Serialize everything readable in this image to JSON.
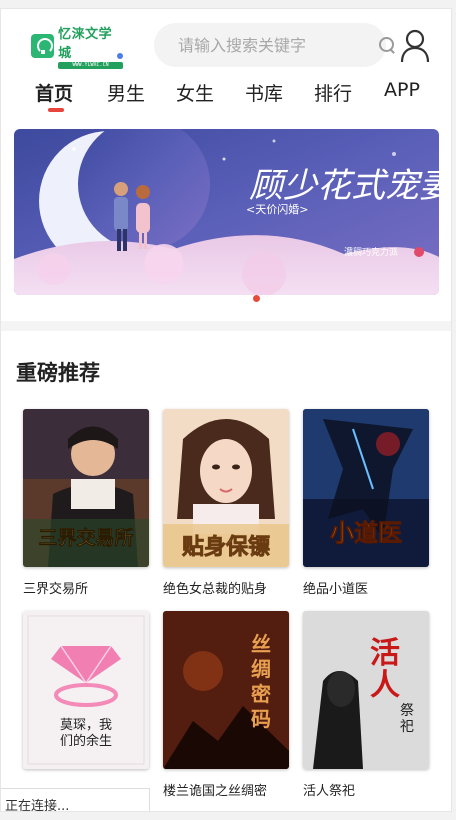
{
  "header": {
    "logo_name": "忆涞文学城",
    "logo_sub": "WWW.YLWXC.CN",
    "search_placeholder": "请输入搜索关键字"
  },
  "nav": {
    "items": [
      {
        "label": "首页",
        "active": true
      },
      {
        "label": "男生",
        "active": false
      },
      {
        "label": "女生",
        "active": false
      },
      {
        "label": "书库",
        "active": false
      },
      {
        "label": "排行",
        "active": false
      },
      {
        "label": "APP",
        "active": false
      }
    ]
  },
  "banner": {
    "title": "顾少花式宠妻",
    "subtitle": "<天价闪婚>",
    "author": "濃稠巧克力派",
    "slide_count": 1,
    "active_slide": 1
  },
  "section": {
    "title": "重磅推荐"
  },
  "books": [
    {
      "title": "三界交易所",
      "cover_text": "三界交易所"
    },
    {
      "title": "绝色女总裁的贴身",
      "cover_text": "贴身保镖"
    },
    {
      "title": "绝品小道医",
      "cover_text": "小道医"
    },
    {
      "title": "莫琛，我们的余生",
      "cover_text": "莫琛，我们的余生"
    },
    {
      "title": "楼兰诡国之丝绸密",
      "cover_text": "丝绸密码"
    },
    {
      "title": "活人祭祀",
      "cover_text": "活人祭祀"
    }
  ],
  "status": {
    "text": "正在连接..."
  },
  "colors": {
    "brand": "#23a05e",
    "accent": "#e8453c"
  }
}
